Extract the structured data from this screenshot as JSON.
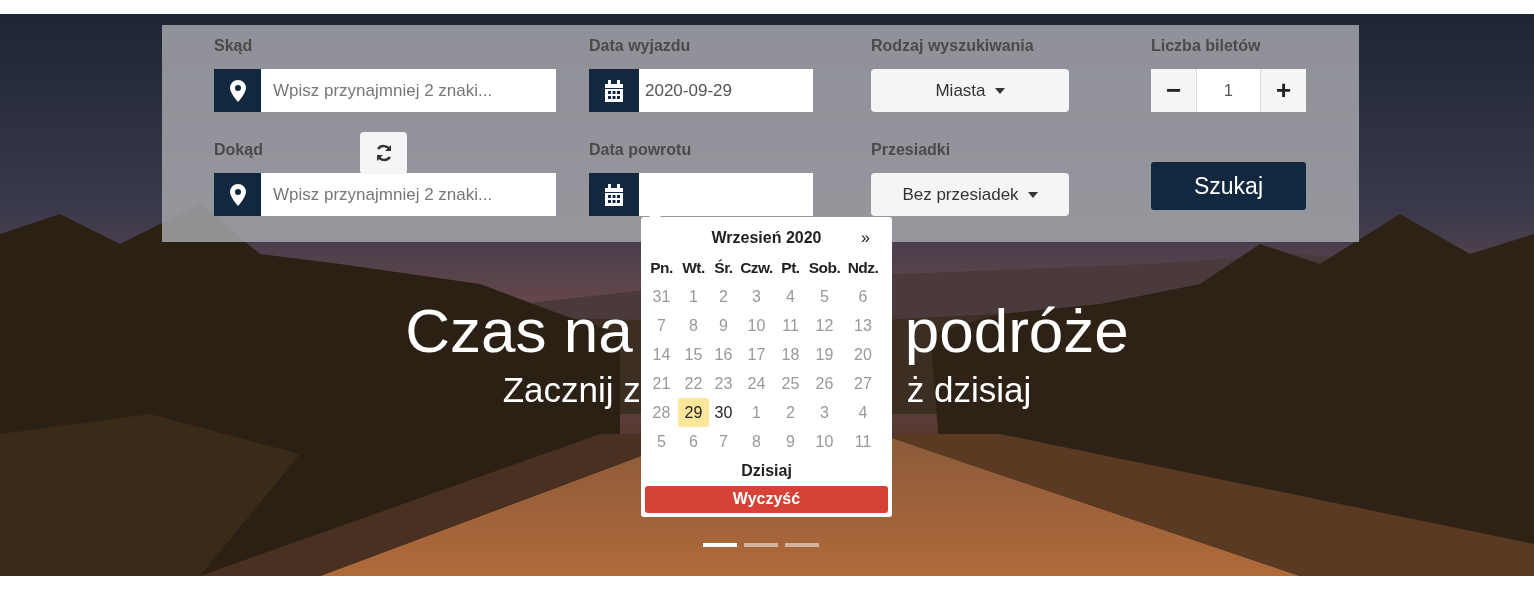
{
  "search_form": {
    "from": {
      "label": "Skąd",
      "placeholder": "Wpisz przynajmniej 2 znaki..."
    },
    "to": {
      "label": "Dokąd",
      "placeholder": "Wpisz przynajmniej 2 znaki..."
    },
    "departure_date": {
      "label": "Data wyjazdu",
      "value": "2020-09-29"
    },
    "return_date": {
      "label": "Data powrotu"
    },
    "search_type": {
      "label": "Rodzaj wyszukiwania",
      "value": "Miasta"
    },
    "transfers": {
      "label": "Przesiadki",
      "value": "Bez przesiadek"
    },
    "tickets": {
      "label": "Liczba biletów",
      "minus": "−",
      "value": "1",
      "plus": "+"
    },
    "submit": "Szukaj"
  },
  "datepicker": {
    "title": "Wrzesień 2020",
    "next": "»",
    "weekdays": [
      "Pn.",
      "Wt.",
      "Śr.",
      "Czw.",
      "Pt.",
      "Sob.",
      "Ndz."
    ],
    "weeks": [
      [
        {
          "day": "31",
          "disabled": true,
          "selected": false
        },
        {
          "day": "1",
          "disabled": true,
          "selected": false
        },
        {
          "day": "2",
          "disabled": true,
          "selected": false
        },
        {
          "day": "3",
          "disabled": true,
          "selected": false
        },
        {
          "day": "4",
          "disabled": true,
          "selected": false
        },
        {
          "day": "5",
          "disabled": true,
          "selected": false
        },
        {
          "day": "6",
          "disabled": true,
          "selected": false
        }
      ],
      [
        {
          "day": "7",
          "disabled": true,
          "selected": false
        },
        {
          "day": "8",
          "disabled": true,
          "selected": false
        },
        {
          "day": "9",
          "disabled": true,
          "selected": false
        },
        {
          "day": "10",
          "disabled": true,
          "selected": false
        },
        {
          "day": "11",
          "disabled": true,
          "selected": false
        },
        {
          "day": "12",
          "disabled": true,
          "selected": false
        },
        {
          "day": "13",
          "disabled": true,
          "selected": false
        }
      ],
      [
        {
          "day": "14",
          "disabled": true,
          "selected": false
        },
        {
          "day": "15",
          "disabled": true,
          "selected": false
        },
        {
          "day": "16",
          "disabled": true,
          "selected": false
        },
        {
          "day": "17",
          "disabled": true,
          "selected": false
        },
        {
          "day": "18",
          "disabled": true,
          "selected": false
        },
        {
          "day": "19",
          "disabled": true,
          "selected": false
        },
        {
          "day": "20",
          "disabled": true,
          "selected": false
        }
      ],
      [
        {
          "day": "21",
          "disabled": true,
          "selected": false
        },
        {
          "day": "22",
          "disabled": true,
          "selected": false
        },
        {
          "day": "23",
          "disabled": true,
          "selected": false
        },
        {
          "day": "24",
          "disabled": true,
          "selected": false
        },
        {
          "day": "25",
          "disabled": true,
          "selected": false
        },
        {
          "day": "26",
          "disabled": true,
          "selected": false
        },
        {
          "day": "27",
          "disabled": true,
          "selected": false
        }
      ],
      [
        {
          "day": "28",
          "disabled": true,
          "selected": false
        },
        {
          "day": "29",
          "disabled": false,
          "selected": true
        },
        {
          "day": "30",
          "disabled": false,
          "selected": false
        },
        {
          "day": "1",
          "disabled": true,
          "selected": false
        },
        {
          "day": "2",
          "disabled": true,
          "selected": false
        },
        {
          "day": "3",
          "disabled": true,
          "selected": false
        },
        {
          "day": "4",
          "disabled": true,
          "selected": false
        }
      ],
      [
        {
          "day": "5",
          "disabled": true,
          "selected": false
        },
        {
          "day": "6",
          "disabled": true,
          "selected": false
        },
        {
          "day": "7",
          "disabled": true,
          "selected": false
        },
        {
          "day": "8",
          "disabled": true,
          "selected": false
        },
        {
          "day": "9",
          "disabled": true,
          "selected": false
        },
        {
          "day": "10",
          "disabled": true,
          "selected": false
        },
        {
          "day": "11",
          "disabled": true,
          "selected": false
        }
      ]
    ],
    "today": "Dzisiaj",
    "clear": "Wyczyść"
  },
  "hero": {
    "headline_parts": [
      "Czas na",
      "podróże"
    ],
    "subtitle_parts": [
      "Zacznij z",
      "ż dzisiaj"
    ]
  },
  "carousel": [
    {
      "selected": true
    },
    {
      "selected": false
    },
    {
      "selected": false
    }
  ]
}
